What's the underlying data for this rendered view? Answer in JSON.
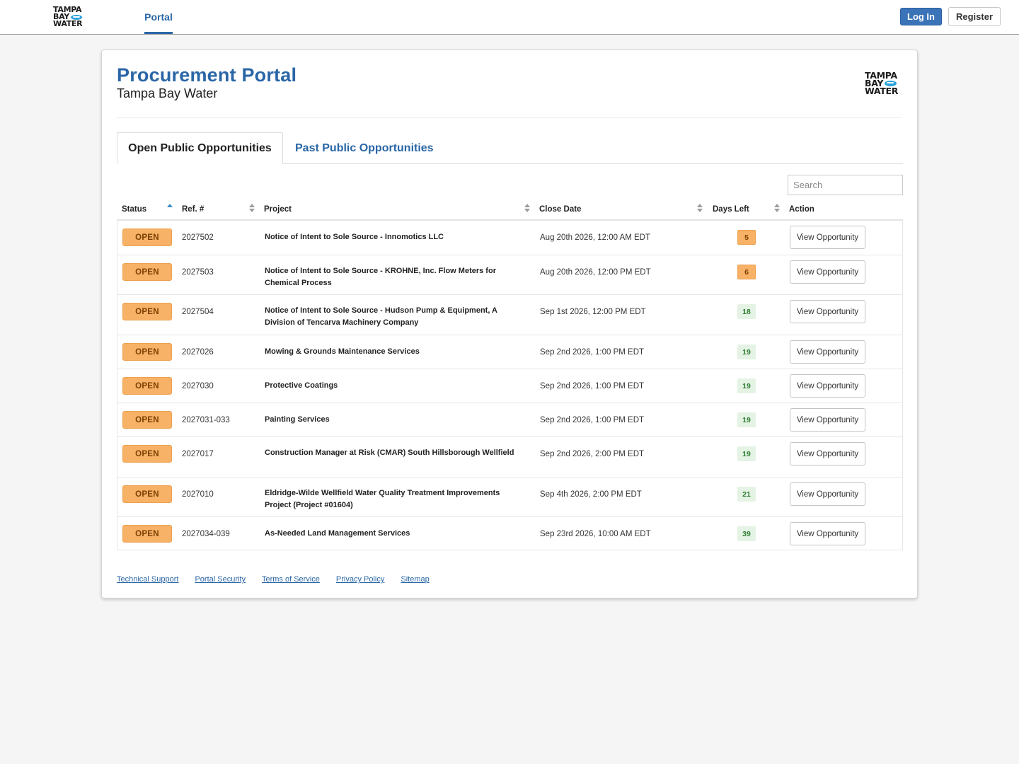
{
  "topbar": {
    "logo_lines": [
      "TAMPA",
      "BAY",
      "WATER"
    ],
    "nav_tab": "Portal",
    "login_label": "Log In",
    "register_label": "Register"
  },
  "header": {
    "title": "Procurement Portal",
    "subtitle": "Tampa Bay Water",
    "logo_lines": [
      "TAMPA",
      "BAY",
      "WATER"
    ]
  },
  "tabs": {
    "active": "Open Public Opportunities",
    "inactive": "Past Public Opportunities"
  },
  "search": {
    "placeholder": "Search"
  },
  "table": {
    "columns": [
      "Status",
      "Ref. #",
      "Project",
      "Close Date",
      "Days Left",
      "Action"
    ],
    "rows": [
      {
        "status": "OPEN",
        "ref": "2027502",
        "project": "Notice of Intent to Sole Source - Innomotics LLC",
        "close_date": "Aug 20th 2026, 12:00 AM EDT",
        "days_left": "5",
        "action": "View Opportunity"
      },
      {
        "status": "OPEN",
        "ref": "2027503",
        "project": "Notice of Intent to Sole Source - KROHNE, Inc. Flow Meters for Chemical Process",
        "close_date": "Aug 20th 2026, 12:00 PM EDT",
        "days_left": "6",
        "action": "View Opportunity"
      },
      {
        "status": "OPEN",
        "ref": "2027504",
        "project": "Notice of Intent to Sole Source - Hudson Pump & Equipment, A Division of Tencarva Machinery Company",
        "close_date": "Sep 1st 2026, 12:00 PM EDT",
        "days_left": "18",
        "action": "View Opportunity"
      },
      {
        "status": "OPEN",
        "ref": "2027026",
        "project": "Mowing & Grounds Maintenance Services",
        "close_date": "Sep 2nd 2026, 1:00 PM EDT",
        "days_left": "19",
        "action": "View Opportunity"
      },
      {
        "status": "OPEN",
        "ref": "2027030",
        "project": "Protective Coatings",
        "close_date": "Sep 2nd 2026, 1:00 PM EDT",
        "days_left": "19",
        "action": "View Opportunity"
      },
      {
        "status": "OPEN",
        "ref": "2027031-033",
        "project": "Painting Services",
        "close_date": "Sep 2nd 2026, 1:00 PM EDT",
        "days_left": "19",
        "action": "View Opportunity"
      },
      {
        "status": "OPEN",
        "ref": "2027017",
        "project": "Construction Manager at Risk (CMAR) South Hillsborough Wellfield",
        "close_date": "Sep 2nd 2026, 2:00 PM EDT",
        "days_left": "19",
        "action": "View Opportunity"
      },
      {
        "status": "OPEN",
        "ref": "2027010",
        "project": "Eldridge-Wilde Wellfield Water Quality Treatment Improvements Project (Project #01604)",
        "close_date": "Sep 4th 2026, 2:00 PM EDT",
        "days_left": "21",
        "action": "View Opportunity"
      },
      {
        "status": "OPEN",
        "ref": "2027034-039",
        "project": "As-Needed Land Management Services",
        "close_date": "Sep 23rd 2026, 10:00 AM EDT",
        "days_left": "39",
        "action": "View Opportunity"
      }
    ]
  },
  "footer": {
    "links": [
      "Technical Support",
      "Portal Security",
      "Terms of Service",
      "Privacy Policy",
      "Sitemap"
    ]
  },
  "colors": {
    "brand_blue": "#2a66a6",
    "open_badge": "#f7b267",
    "days_ok_bg": "#e4f3e4",
    "days_ok_text": "#2f7d32"
  }
}
